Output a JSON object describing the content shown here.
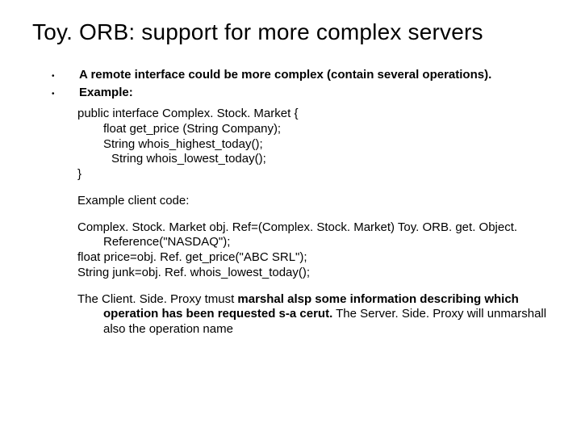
{
  "title": "Toy. ORB:  support for more complex servers",
  "bullets": [
    "A remote interface could be more complex (contain several operations).",
    "Example:"
  ],
  "code1": {
    "l1": "public interface Complex. Stock. Market {",
    "l2": "float get_price (String Company);",
    "l3": "String whois_highest_today();",
    "l4": "String whois_lowest_today();",
    "l5": "}"
  },
  "label_client": "Example client code:",
  "code2": {
    "l1": "Complex. Stock. Market obj. Ref=(Complex. Stock. Market) Toy. ORB. get. Object. Reference(\"NASDAQ\");",
    "l2": "float price=obj. Ref. get_price(\"ABC SRL\");",
    "l3": "String junk=obj. Ref. whois_lowest_today();"
  },
  "final": {
    "p1a": "The Client. Side. Proxy tmust ",
    "p1b": " marshal alsp some information describing which operation has been requested s-a cerut.",
    "p1c": "  The Server. Side. Proxy will unmarshall also the operation name"
  }
}
